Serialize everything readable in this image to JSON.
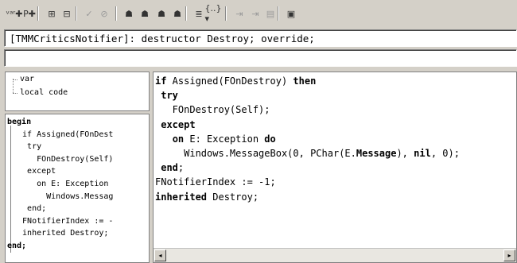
{
  "toolbar": {
    "buttons": [
      {
        "name": "add-var-icon",
        "glyph": "ᵛᵃʳ✚"
      },
      {
        "name": "add-method-icon",
        "glyph": "P✚"
      },
      {
        "name": "insert-block-icon",
        "glyph": "⊞"
      },
      {
        "name": "insert-block-2-icon",
        "glyph": "⊟"
      },
      {
        "name": "check-icon",
        "glyph": "✓"
      },
      {
        "name": "cancel-icon",
        "glyph": "⊘"
      },
      {
        "name": "tool-1-icon",
        "glyph": "☗"
      },
      {
        "name": "tool-2-icon",
        "glyph": "☗"
      },
      {
        "name": "tool-3-icon",
        "glyph": "☗"
      },
      {
        "name": "tool-4-icon",
        "glyph": "☗"
      },
      {
        "name": "format-icon",
        "glyph": "≣"
      },
      {
        "name": "braces-dropdown-icon",
        "glyph": "{..}▾"
      },
      {
        "name": "step-icon",
        "glyph": "⇥"
      },
      {
        "name": "step-next-icon",
        "glyph": "⇥"
      },
      {
        "name": "table-icon",
        "glyph": "▤"
      },
      {
        "name": "window-icon",
        "glyph": "▣"
      }
    ]
  },
  "declaration": "[TMMCriticsNotifier]: destructor Destroy; override;",
  "tree": {
    "items": [
      "var",
      "local code"
    ]
  },
  "outline": {
    "lines": [
      "begin",
      "  if Assigned(FOnDest",
      "   try",
      "     FOnDestroy(Self)",
      "   except",
      "     on E: Exception",
      "       Windows.Messag",
      "   end;",
      "  FNotifierIndex := -",
      "  inherited Destroy;",
      "end;"
    ]
  },
  "editor": {
    "lines": [
      [
        {
          "t": "if",
          "kw": true
        },
        {
          "t": " Assigned(FOnDestroy) "
        },
        {
          "t": "then",
          "kw": true
        }
      ],
      [
        {
          "t": " "
        },
        {
          "t": "try",
          "kw": true
        }
      ],
      [
        {
          "t": "   FOnDestroy(Self);"
        }
      ],
      [
        {
          "t": " "
        },
        {
          "t": "except",
          "kw": true
        }
      ],
      [
        {
          "t": "   "
        },
        {
          "t": "on",
          "kw": true
        },
        {
          "t": " E: Exception "
        },
        {
          "t": "do",
          "kw": true
        }
      ],
      [
        {
          "t": "     Windows.MessageBox(0, PChar(E."
        },
        {
          "t": "Message",
          "kw": true
        },
        {
          "t": "), "
        },
        {
          "t": "nil",
          "kw": true
        },
        {
          "t": ", 0);"
        }
      ],
      [
        {
          "t": " "
        },
        {
          "t": "end",
          "kw": true
        },
        {
          "t": ";"
        }
      ],
      [
        {
          "t": "FNotifierIndex := -1;"
        }
      ],
      [
        {
          "t": "inherited",
          "kw": true
        },
        {
          "t": " Destroy;"
        }
      ]
    ]
  },
  "scrollbar": {
    "left_arrow": "◂",
    "right_arrow": "▸"
  }
}
